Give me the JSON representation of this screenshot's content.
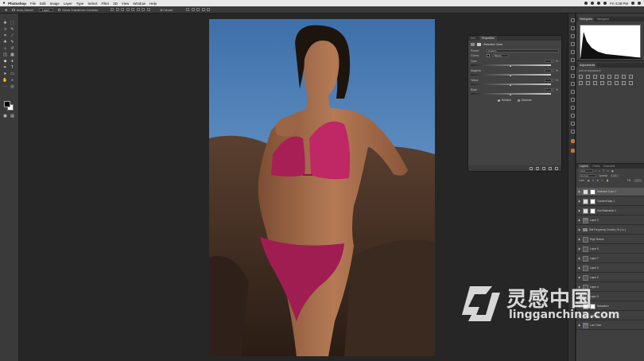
{
  "menubar": {
    "app_name": "Photoshop",
    "items": [
      "File",
      "Edit",
      "Image",
      "Layer",
      "Type",
      "Select",
      "Filter",
      "3D",
      "View",
      "Window",
      "Help"
    ],
    "clock": "Fri 4:38 PM"
  },
  "options_bar": {
    "auto_select_label": "Auto-Select:",
    "auto_select_value": "Layer",
    "show_transform_label": "Show Transform Controls",
    "mode_3d_label": "3D Mode:"
  },
  "properties": {
    "tabs": [
      "Info",
      "Properties"
    ],
    "title": "Selective Color",
    "preset_label": "Preset:",
    "preset_value": "Custom",
    "colors_label": "Colors:",
    "colors_value": "Blacks",
    "sliders": [
      {
        "name": "Cyan",
        "value": "0",
        "level": 50
      },
      {
        "name": "Magenta",
        "value": "0",
        "level": 50
      },
      {
        "name": "Yellow",
        "value": "0",
        "level": 50
      },
      {
        "name": "Black",
        "value": "0",
        "level": 50
      }
    ],
    "pct": "%",
    "relative_label": "Relative",
    "absolute_label": "Absolute"
  },
  "histogram": {
    "tabs": [
      "Histogram",
      "Navigator"
    ]
  },
  "adjustments": {
    "tab": "Adjustments",
    "add_label": "Add an adjustment"
  },
  "layers": {
    "tabs": [
      "Layers",
      "Paths",
      "Channels"
    ],
    "kind_label": "Kind",
    "blend_mode": "Normal",
    "opacity_label": "Opacity:",
    "opacity_value": "100%",
    "lock_label": "Lock:",
    "fill_label": "Fill:",
    "fill_value": "100%",
    "items": [
      {
        "name": "Selective Color 1",
        "selected": true,
        "thumb": "adj"
      },
      {
        "name": "Gradient Map 1",
        "selected": false,
        "thumb": "adj"
      },
      {
        "name": "Hue/Saturation 1",
        "selected": false,
        "thumb": "adj"
      },
      {
        "name": "Layer 9",
        "selected": false,
        "thumb": "photo"
      },
      {
        "name": "Still Frequency Control ( Hi | Lo )",
        "selected": false,
        "thumb": "folder"
      },
      {
        "name": "High Texture",
        "selected": false,
        "thumb": "dark"
      },
      {
        "name": "Layer 8",
        "selected": false,
        "thumb": "dark"
      },
      {
        "name": "Layer 7",
        "selected": false,
        "thumb": "dark"
      },
      {
        "name": "Layer 6",
        "selected": false,
        "thumb": "dark"
      },
      {
        "name": "Layer 5",
        "selected": false,
        "thumb": "dark"
      },
      {
        "name": "Layer 4",
        "selected": false,
        "thumb": "dark"
      },
      {
        "name": "Layer 3",
        "selected": false,
        "thumb": "dark"
      },
      {
        "name": "Saturation",
        "selected": false,
        "thumb": "adj"
      },
      {
        "name": "Layer 2",
        "selected": false,
        "thumb": "dark"
      },
      {
        "name": "Low Color",
        "selected": false,
        "thumb": "photo"
      }
    ]
  },
  "watermark": {
    "name": "灵感中国",
    "url": "lingganchina.com"
  }
}
